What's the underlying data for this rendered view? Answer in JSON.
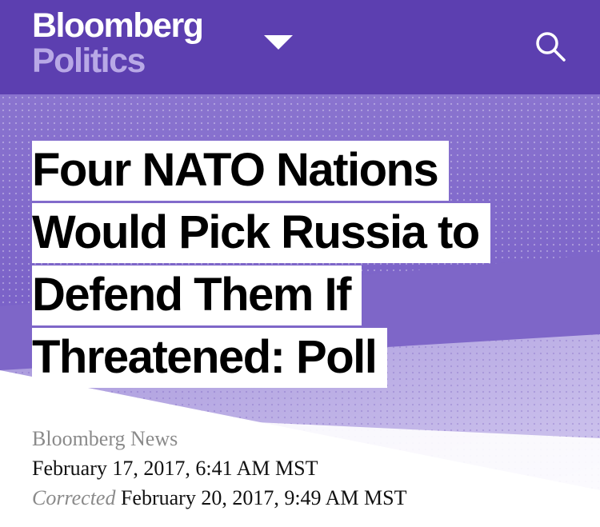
{
  "header": {
    "brand_name": "Bloomberg",
    "section_name": "Politics",
    "menu_icon": "chevron-down-icon",
    "search_icon": "search-icon",
    "colors": {
      "background": "#5c3fb0",
      "section_text": "#b8a8e6"
    }
  },
  "article": {
    "headline": "Four NATO Nations Would Pick Russia to Defend Them If Threatened: Poll",
    "author": "Bloomberg News",
    "published": "February 17, 2017, 6:41 AM MST",
    "corrected_label": "Corrected",
    "corrected_date": "February 20, 2017, 9:49 AM MST"
  }
}
